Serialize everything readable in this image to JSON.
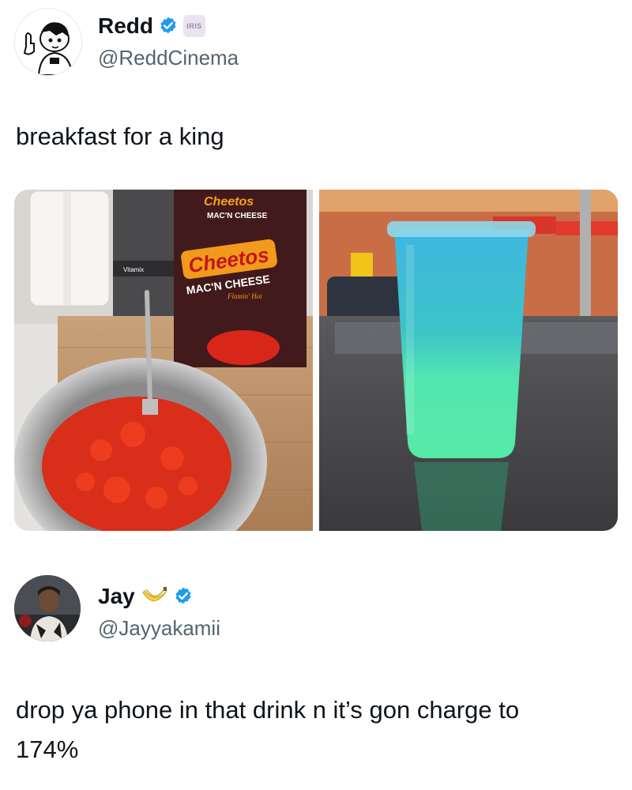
{
  "post1": {
    "display_name": "Redd",
    "badge_text": "IRIS",
    "handle": "@ReddCinema",
    "text": "breakfast for a king",
    "media": {
      "left_alt": "Red Flamin' Hot mac and cheese in a metal bowl with a fork, next to the box",
      "right_alt": "Blue and green drink in a clear plastic cup sitting on a car roof",
      "box_brand": "Cheetos",
      "box_product": "MAC'N CHEESE",
      "box_flavor": "Flamin' Hot",
      "blender_brand": "Vitamix"
    }
  },
  "post2": {
    "display_name": "Jay",
    "handle": "@Jayyakamii",
    "text_line1": "drop ya phone in that drink n it’s gon charge  to",
    "text_line2": "174%"
  },
  "colors": {
    "verified_blue": "#1d9bf0",
    "text_primary": "#0f1419",
    "text_secondary": "#536471"
  },
  "icons": [
    "verified-badge-icon",
    "iris-badge-icon",
    "bananas-emoji-icon"
  ]
}
